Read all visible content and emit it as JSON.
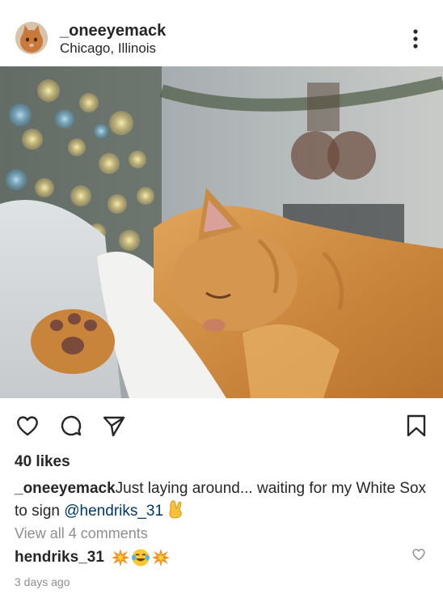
{
  "post": {
    "username": "_oneeyemack",
    "location": "Chicago, Illinois"
  },
  "photo": {
    "alt": "photo"
  },
  "actions": {
    "like_icon": "heart-outline-icon",
    "comment_icon": "comment-bubble-icon",
    "share_icon": "paper-plane-icon",
    "save_icon": "bookmark-icon"
  },
  "likes": "40 likes",
  "caption": {
    "username": "_oneeyemack",
    "text": "Just laying around... waiting for my White Sox to sign ",
    "mention": "@hendriks_31",
    "emoji": "crossed-fingers"
  },
  "comments": {
    "view_all": "View all 4 comments",
    "items": [
      {
        "username": "hendriks_31",
        "emojis": [
          "collision",
          "face-with-tears-of-joy",
          "collision"
        ]
      }
    ]
  },
  "timestamp": "3 days ago",
  "colors": {
    "text": "#262626",
    "muted": "#8e8e8e",
    "mention": "#00376b",
    "background": "#ffffff"
  }
}
